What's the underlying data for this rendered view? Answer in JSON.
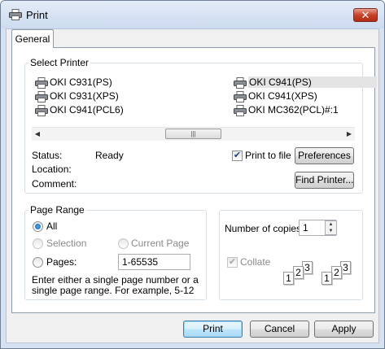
{
  "window": {
    "title": "Print",
    "close_glyph": "✕"
  },
  "tabs": [
    {
      "label": "General",
      "active": true
    }
  ],
  "select_printer": {
    "legend": "Select Printer",
    "printers": [
      {
        "name": "OKI C931(PS)"
      },
      {
        "name": "OKI C931(XPS)"
      },
      {
        "name": "OKI C941(PCL6)"
      },
      {
        "name": "OKI C941(PS)",
        "selected": true
      },
      {
        "name": "OKI C941(XPS)"
      },
      {
        "name": "OKI MC362(PCL)#:1"
      }
    ],
    "scroll_left_glyph": "◀",
    "scroll_right_glyph": "▶",
    "scroll_thumb_glyph": "|||",
    "status_label": "Status:",
    "status_value": "Ready",
    "location_label": "Location:",
    "location_value": "",
    "comment_label": "Comment:",
    "comment_value": "",
    "print_to_file_label": "Print to file",
    "print_to_file_checked": true,
    "preferences_label": "Preferences",
    "find_printer_label": "Find Printer..."
  },
  "page_range": {
    "legend": "Page Range",
    "all_label": "All",
    "selection_label": "Selection",
    "current_page_label": "Current Page",
    "pages_label": "Pages:",
    "pages_value": "1-65535",
    "selected_option": "All",
    "hint": "Enter either a single page number or a single page range.  For example, 5-12"
  },
  "copies": {
    "label": "Number of copies:",
    "value": "1",
    "collate_label": "Collate",
    "collate_checked": true,
    "collate_enabled": false,
    "up_glyph": "▲",
    "down_glyph": "▼",
    "page_numbers": [
      "1",
      "2",
      "3"
    ]
  },
  "buttons": {
    "print": "Print",
    "cancel": "Cancel",
    "apply": "Apply"
  },
  "icons": {
    "title": "printer-icon",
    "printer_item": "printer-icon",
    "close": "close-icon",
    "check": "checkmark-icon"
  },
  "colors": {
    "title_bar": "#cddbf0",
    "close_button": "#c7422a",
    "accent": "#3c7fb1"
  }
}
